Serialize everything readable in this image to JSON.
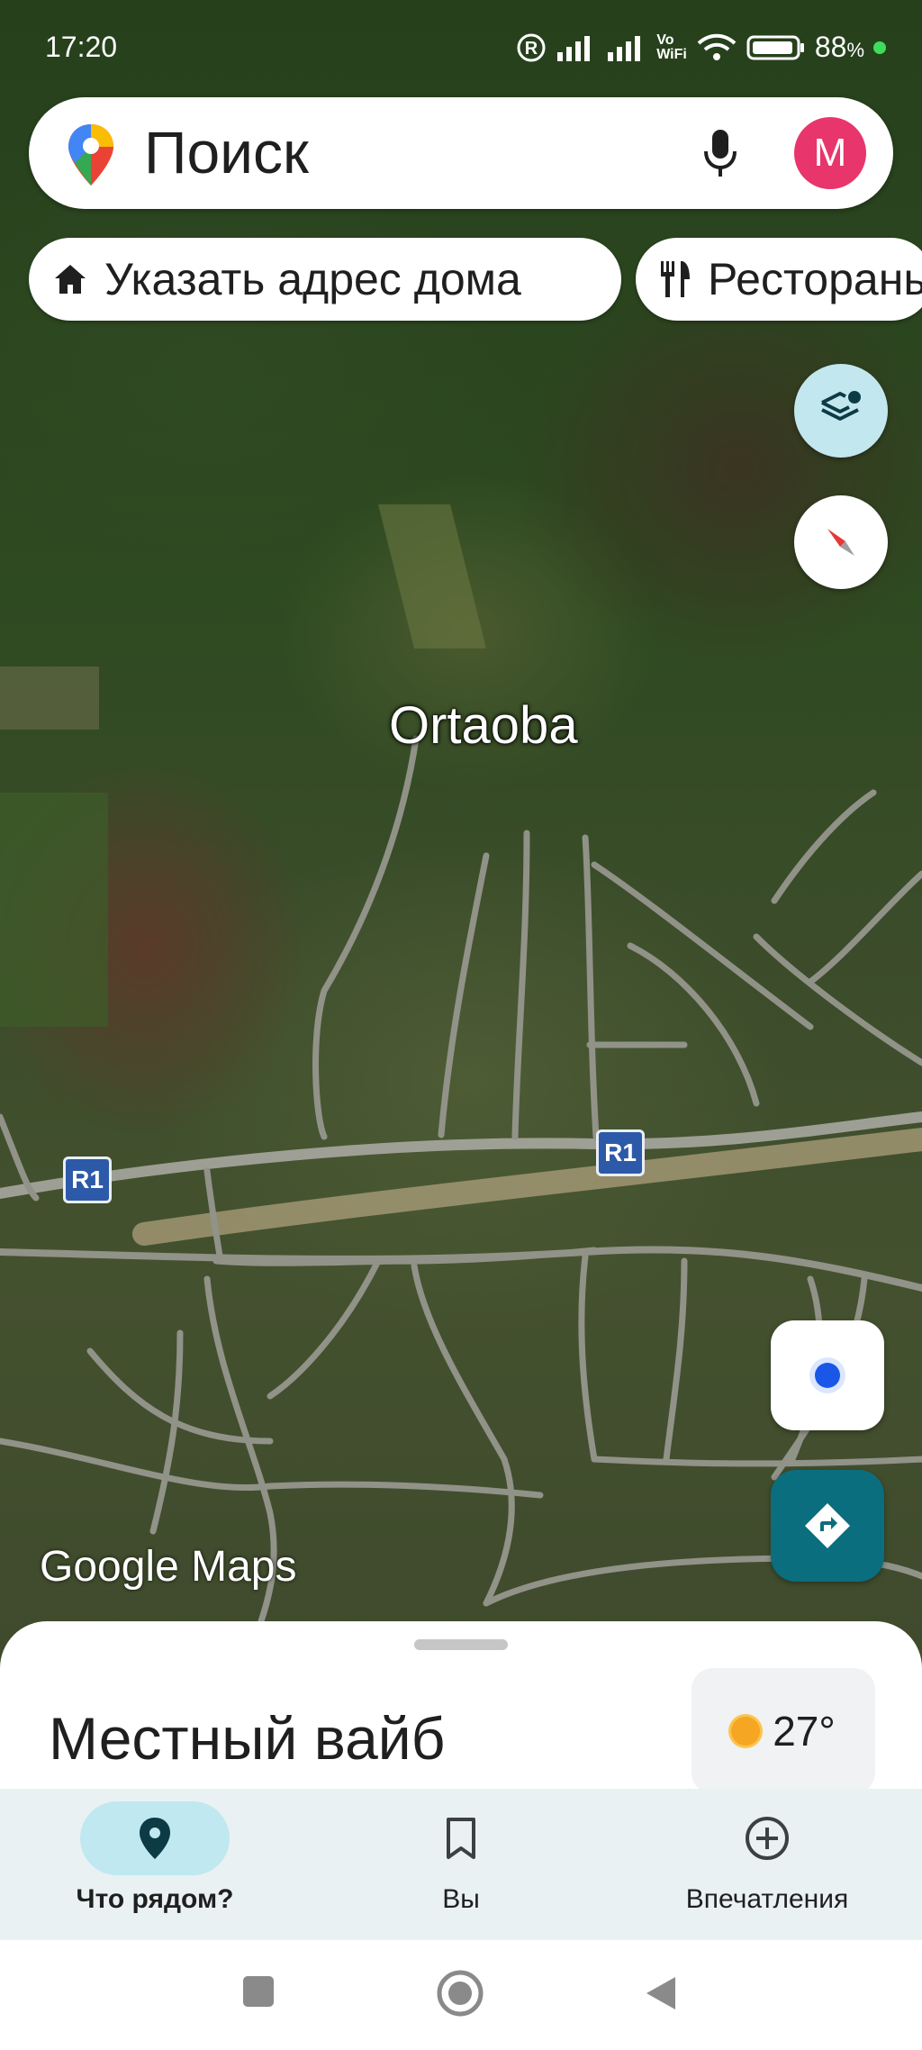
{
  "status_bar": {
    "time": "17:20",
    "battery": "88",
    "battery_unit": "%",
    "vowifi": "Vo\nWiFi"
  },
  "search": {
    "placeholder": "Поиск",
    "avatar_letter": "M"
  },
  "chips": [
    {
      "label": "Указать адрес дома",
      "icon": "home-icon"
    },
    {
      "label": "Рестораны",
      "icon": "restaurant-icon"
    }
  ],
  "map": {
    "place_label": "Ortaoba",
    "road_shield_1": "R1",
    "road_shield_2": "R1",
    "attribution": "Google Maps"
  },
  "sheet": {
    "title": "Местный вайб",
    "weather": {
      "temperature": "27°",
      "icon": "sun-icon"
    }
  },
  "bottom_nav": [
    {
      "label": "Что рядом?",
      "icon": "location-pin-icon",
      "active": true
    },
    {
      "label": "Вы",
      "icon": "bookmark-icon",
      "active": false
    },
    {
      "label": "Впечатления",
      "icon": "add-circle-icon",
      "active": false
    }
  ],
  "colors": {
    "accent": "#0b6e7e",
    "avatar": "#e8356b",
    "active_pill": "#bfe8f0",
    "shield": "#2d5aa8"
  }
}
